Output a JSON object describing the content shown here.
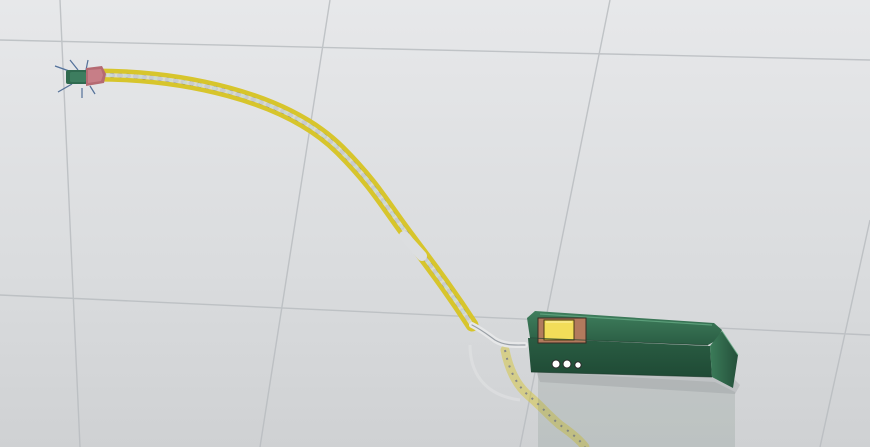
{
  "scene": {
    "kind": "3d-cad-viewport",
    "background_color": "#dcdee0",
    "grid_color": "#b9bcbf",
    "objects": [
      {
        "name": "robot-head-module",
        "colors": {
          "body": "#2f6a4f",
          "cap": "#b56a72"
        }
      },
      {
        "name": "articulated-cable-chain",
        "colors": {
          "link": "#d7c52c",
          "joint": "#2b2b2b",
          "marker": "#38c43c",
          "core": "#d9dde1"
        }
      },
      {
        "name": "control-box",
        "colors": {
          "body": "#2f6a48",
          "panel": "#b27a5d",
          "button": "#f2dd59",
          "ports": "#ffffff"
        }
      },
      {
        "name": "mirror-reflection",
        "colors": {
          "ghost": "#c7b45a"
        }
      }
    ]
  }
}
